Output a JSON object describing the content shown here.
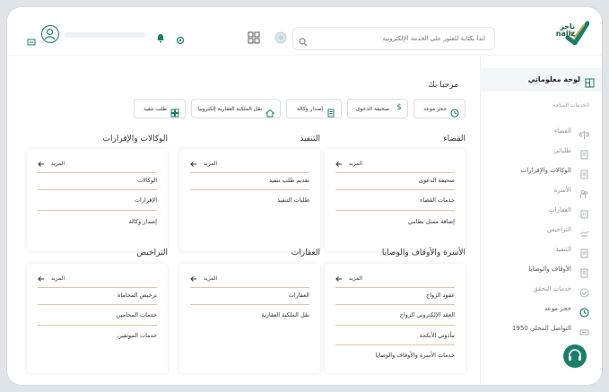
{
  "header": {
    "logo_text": "ناجز",
    "logo_sub": "najiz",
    "search_placeholder": "ابدأ بكتابة للعثور على الخدمة الإلكترونية"
  },
  "sidebar": {
    "dashboard": "لوحة معلوماتي",
    "section_label": "الخدمات المتاحة",
    "items": [
      {
        "label": "القضاء",
        "icon": "scales-icon"
      },
      {
        "label": "طلباتي",
        "icon": "document-icon"
      },
      {
        "label": "الوكالات والإقرارات",
        "icon": "document-icon"
      },
      {
        "label": "الأسرة",
        "icon": "family-icon"
      },
      {
        "label": "العقارات",
        "icon": "building-icon"
      },
      {
        "label": "التراخيص",
        "icon": "license-icon"
      },
      {
        "label": "التنفيذ",
        "icon": "document-icon"
      },
      {
        "label": "الأوقاف والوصايا",
        "icon": "document-icon"
      },
      {
        "label": "خدمات التحقق",
        "icon": "check-icon"
      },
      {
        "label": "حجز موعد",
        "icon": "clock-icon"
      },
      {
        "label": "التواصل المحلي 1950",
        "icon": "phone-icon"
      }
    ]
  },
  "main": {
    "welcome": "مرحبا بك",
    "quick_actions": [
      {
        "label": "حجز موعد",
        "icon": "clock-icon"
      },
      {
        "label": "صحيفة الدعوى",
        "icon": "dollar-icon"
      },
      {
        "label": "إصدار وكالة",
        "icon": "document-icon"
      },
      {
        "label": "نقل الملكية العقارية إلكترونيا",
        "icon": "home-icon"
      },
      {
        "label": "طلب تنفيذ",
        "icon": "grid-icon"
      }
    ],
    "more_label": "المزيد",
    "sections": [
      {
        "title": "القضاء",
        "items": [
          "صحيفة الدعوى",
          "خدمات القضاء",
          "إضافة ممثل نظامي"
        ]
      },
      {
        "title": "التنفيذ",
        "items": [
          "تقديم طلب تنفيذ",
          "طلبات التنفيذ"
        ]
      },
      {
        "title": "الوكالات والإقرارات",
        "items": [
          "الوكالات",
          "الإقرارات",
          "إصدار وكالة"
        ]
      },
      {
        "title": "الأسرة والأوقاف والوصايا",
        "items": [
          "عقود الزواج",
          "العقد الإلكتروني الزواج",
          "مأذوني الأنكحة",
          "خدمات الأسرة والأوقاف والوصايا"
        ]
      },
      {
        "title": "العقارات",
        "items": [
          "العقارات",
          "نقل الملكية العقارية"
        ]
      },
      {
        "title": "التراخيص",
        "items": [
          "ترخيص المحاماة",
          "خدمات المحامين",
          "خدمات الموثقين"
        ]
      }
    ]
  },
  "colors": {
    "brand": "#1b7e6a",
    "divider": "#d8c9a8"
  }
}
